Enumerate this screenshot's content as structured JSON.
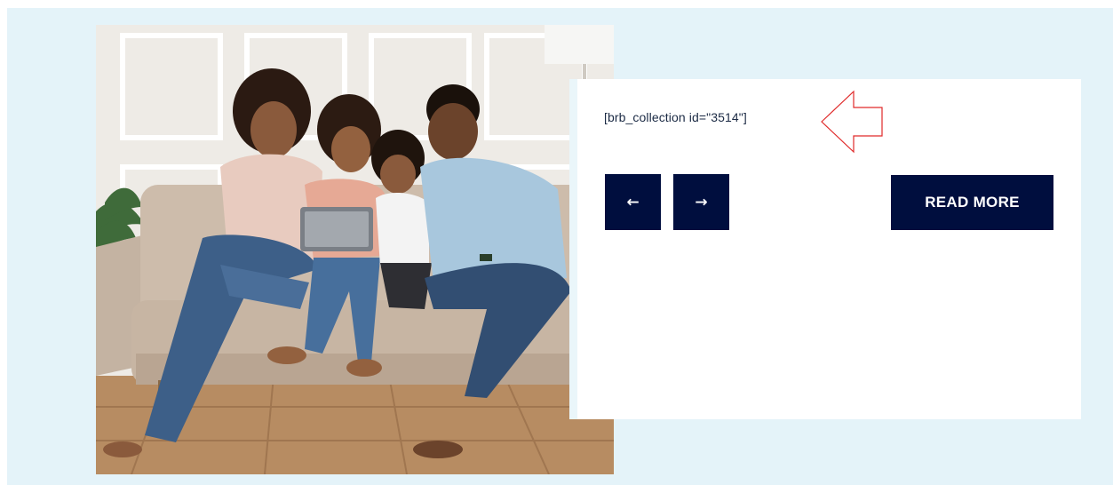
{
  "slider": {
    "shortcode_text": "[brb_collection id=\"3514\"]",
    "prev_glyph": "←",
    "next_glyph": "→",
    "read_more_label": "READ MORE"
  },
  "image": {
    "subject": "family-on-sofa-with-tablet"
  },
  "annotation": {
    "icon": "left-arrow-outline-icon",
    "color": "#e02a2a"
  },
  "colors": {
    "section_background": "#e4f3f9",
    "button_background": "#000e3e",
    "button_text": "#ffffff",
    "card_background": "#ffffff"
  }
}
